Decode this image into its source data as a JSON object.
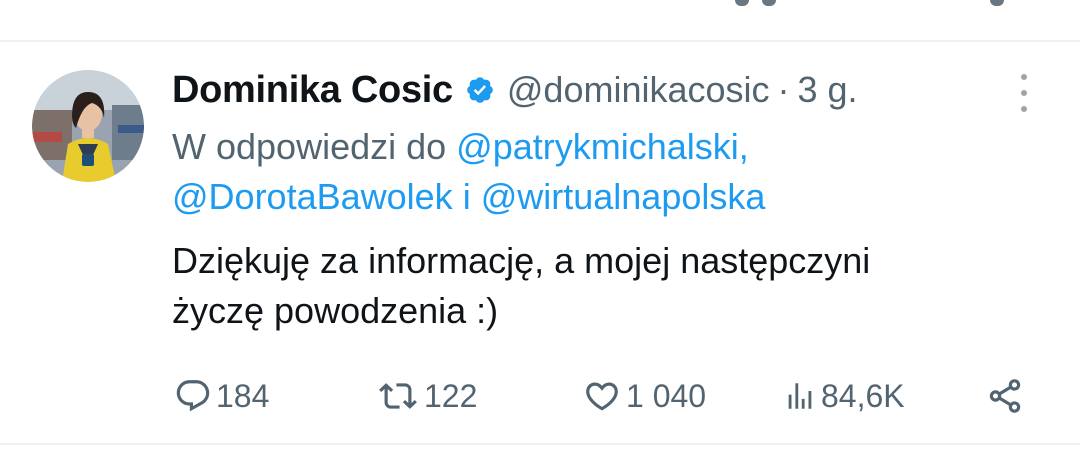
{
  "tweet": {
    "display_name": "Dominika Cosic",
    "handle": "@dominikacosic",
    "separator": "·",
    "time": "3 g.",
    "replying_prefix": "W odpowiedzi do",
    "mention_1": "@patrykmichalski,",
    "mention_2": "@DorotaBawolek",
    "replying_and": "i",
    "mention_3": "@wirtualnapolska",
    "text_line_1": "Dziękuję za informację, a mojej następczyni",
    "text_line_2": "życzę powodzenia :)"
  },
  "actions": {
    "replies": "184",
    "retweets": "122",
    "likes": "1 040",
    "views": "84,6K"
  },
  "icons": {
    "verified": "verified-badge-icon",
    "more": "more-vertical-icon",
    "reply": "reply-icon",
    "retweet": "retweet-icon",
    "like": "heart-icon",
    "views": "views-icon",
    "share": "share-icon"
  },
  "colors": {
    "accent": "#1d9bf0",
    "text_primary": "#0f1419",
    "text_secondary": "#536471",
    "divider": "#eef1f3"
  }
}
